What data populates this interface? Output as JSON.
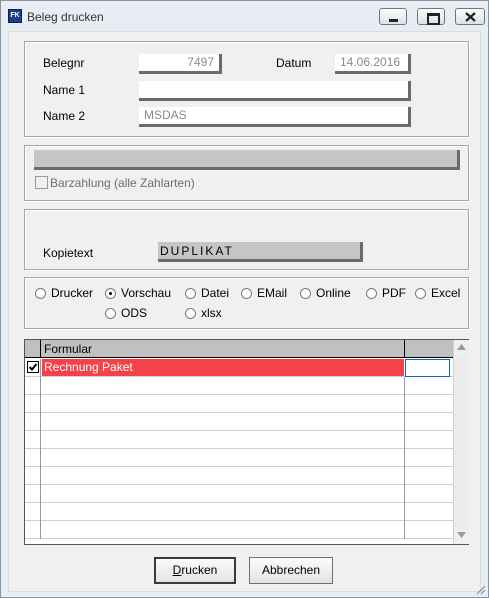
{
  "window": {
    "title": "Beleg drucken",
    "icon": "app-icon"
  },
  "form": {
    "belegnr_label": "Belegnr",
    "belegnr_value": "7497",
    "datum_label": "Datum",
    "datum_value": "14.06.2016",
    "name1_label": "Name 1",
    "name1_value": "",
    "name2_label": "Name 2",
    "name2_value": "MSDAS"
  },
  "payment": {
    "barzahlung_label": "Barzahlung (alle Zahlarten)",
    "barzahlung_checked": false
  },
  "copy": {
    "kopietext_label": "Kopietext",
    "kopietext_value": "DUPLIKAT"
  },
  "output": {
    "options": [
      {
        "label": "Drucker",
        "checked": false
      },
      {
        "label": "Vorschau",
        "checked": true
      },
      {
        "label": "Datei",
        "checked": false
      },
      {
        "label": "EMail",
        "checked": false
      },
      {
        "label": "Online",
        "checked": false
      },
      {
        "label": "PDF",
        "checked": false
      },
      {
        "label": "Excel",
        "checked": false
      },
      {
        "label": "ODS",
        "checked": false
      },
      {
        "label": "xlsx",
        "checked": false
      }
    ]
  },
  "grid": {
    "column_header": "Formular",
    "rows": [
      {
        "name": "Rechnung Paket",
        "checked": true
      }
    ]
  },
  "buttons": {
    "print_prefix": "D",
    "print_rest": "rucken",
    "cancel": "Abbrechen"
  }
}
